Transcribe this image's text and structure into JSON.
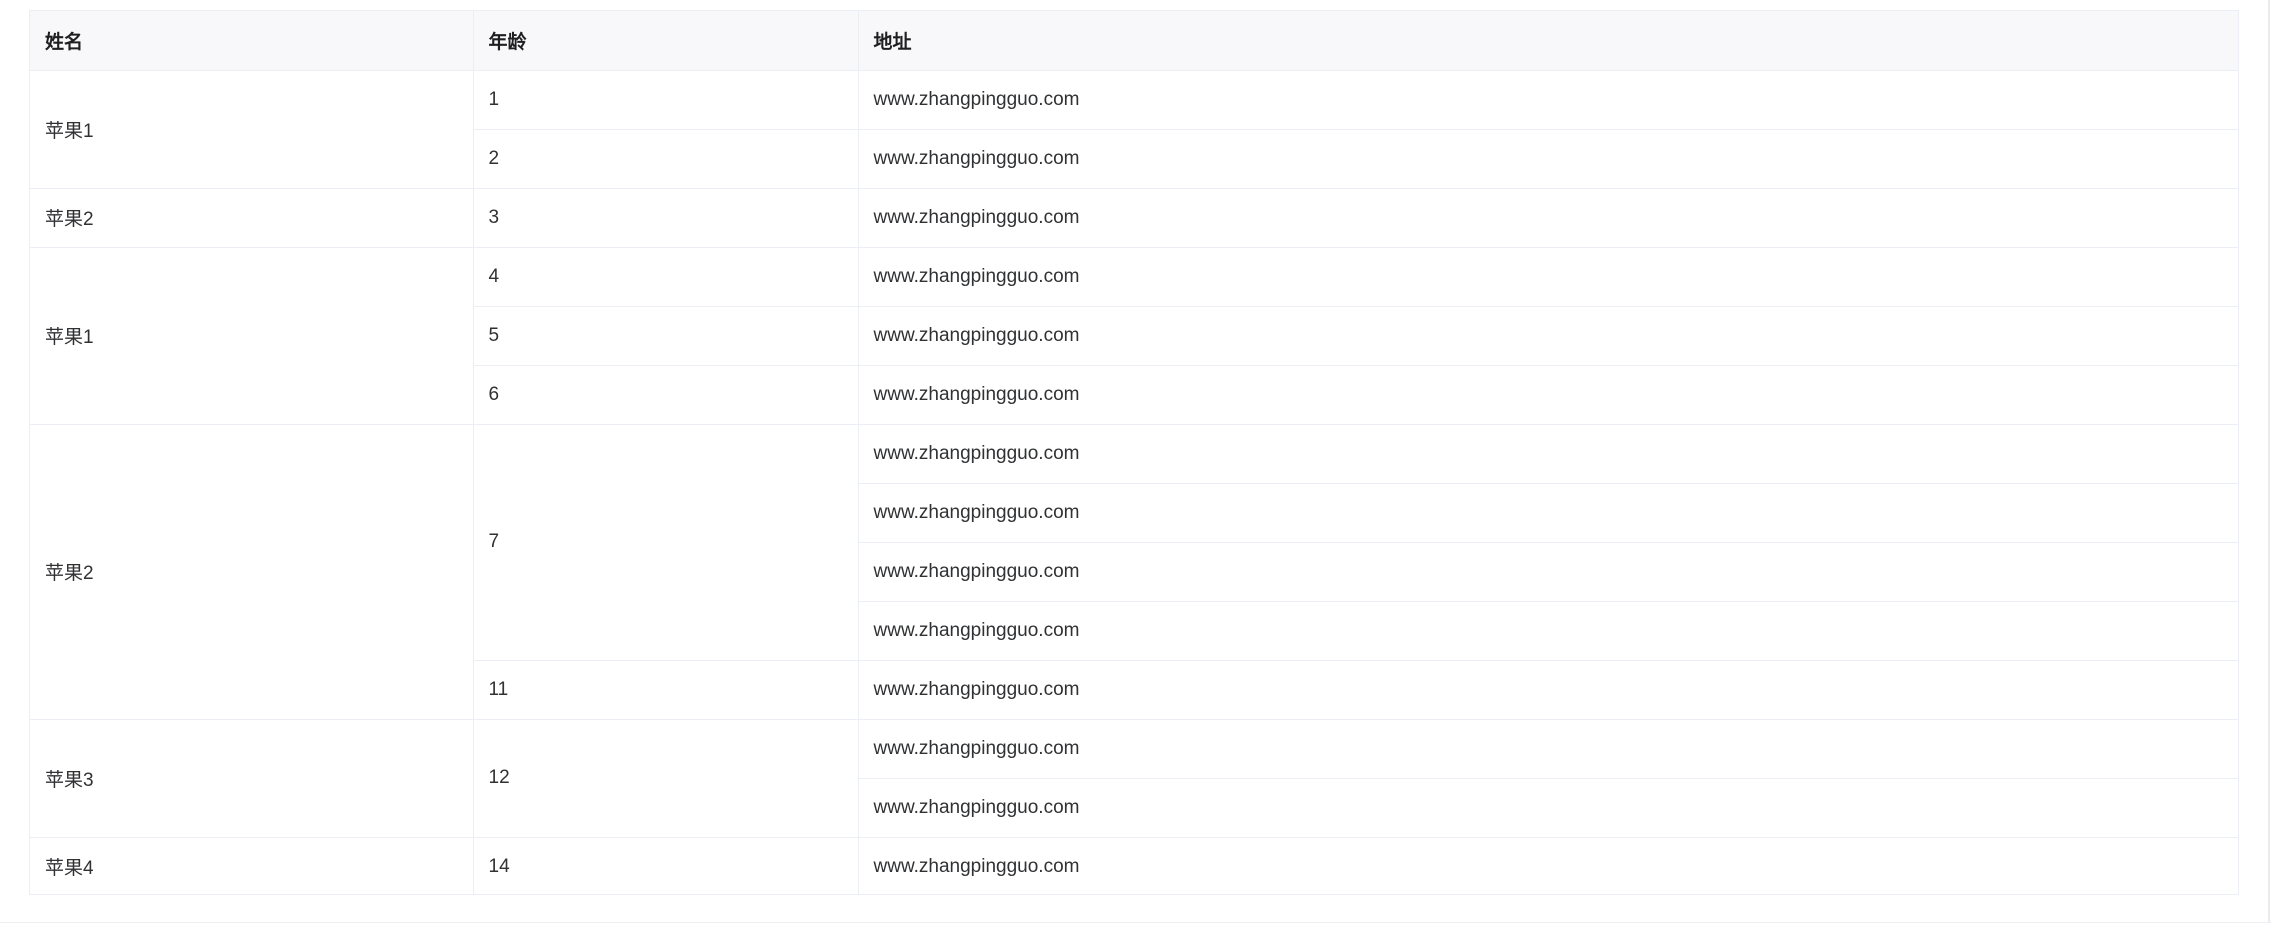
{
  "table": {
    "headers": {
      "name": "姓名",
      "age": "年龄",
      "address": "地址"
    },
    "rows": [
      {
        "name": "苹果1",
        "name_rowspan": 2,
        "age": "1",
        "age_rowspan": 1,
        "address": "www.zhangpingguo.com"
      },
      {
        "age": "2",
        "age_rowspan": 1,
        "address": "www.zhangpingguo.com"
      },
      {
        "name": "苹果2",
        "name_rowspan": 1,
        "age": "3",
        "age_rowspan": 1,
        "address": "www.zhangpingguo.com"
      },
      {
        "name": "苹果1",
        "name_rowspan": 3,
        "age": "4",
        "age_rowspan": 1,
        "address": "www.zhangpingguo.com"
      },
      {
        "age": "5",
        "age_rowspan": 1,
        "address": "www.zhangpingguo.com"
      },
      {
        "age": "6",
        "age_rowspan": 1,
        "address": "www.zhangpingguo.com"
      },
      {
        "name": "苹果2",
        "name_rowspan": 5,
        "age": "7",
        "age_rowspan": 4,
        "address": "www.zhangpingguo.com"
      },
      {
        "address": "www.zhangpingguo.com"
      },
      {
        "address": "www.zhangpingguo.com"
      },
      {
        "address": "www.zhangpingguo.com"
      },
      {
        "age": "11",
        "age_rowspan": 1,
        "address": "www.zhangpingguo.com"
      },
      {
        "name": "苹果3",
        "name_rowspan": 2,
        "age": "12",
        "age_rowspan": 2,
        "address": "www.zhangpingguo.com"
      },
      {
        "address": "www.zhangpingguo.com"
      },
      {
        "name": "苹果4",
        "name_rowspan": 1,
        "age": "14",
        "age_rowspan": 1,
        "address": "www.zhangpingguo.com"
      }
    ]
  }
}
